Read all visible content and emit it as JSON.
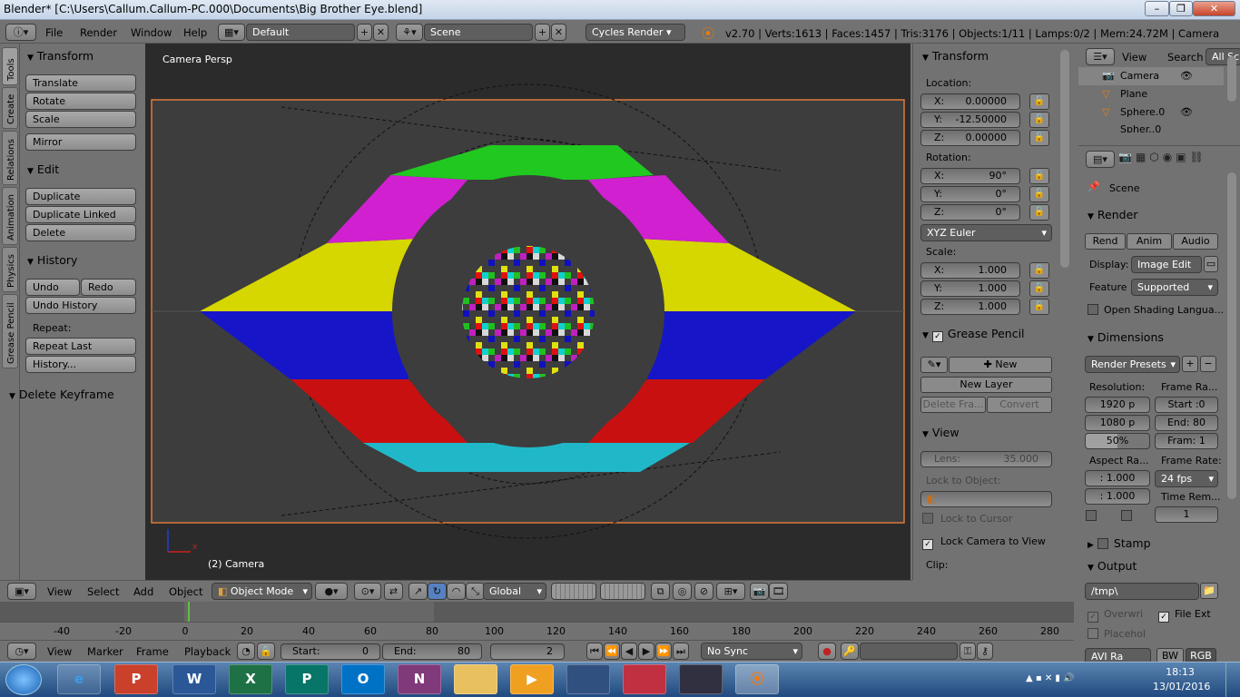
{
  "window": {
    "title": "Blender* [C:\\Users\\Callum.Callum-PC.000\\Documents\\Big Brother Eye.blend]",
    "minimize": "–",
    "maximize": "❐",
    "close": "✕"
  },
  "infobar": {
    "menus": [
      "File",
      "Render",
      "Window",
      "Help"
    ],
    "layout": "Default",
    "scene": "Scene",
    "engine": "Cycles Render",
    "stats": "v2.70 | Verts:1613 | Faces:1457 | Tris:3176 | Objects:1/11 | Lamps:0/2 | Mem:24.72M | Camera"
  },
  "tools": {
    "tabs": [
      "Tools",
      "Create",
      "Relations",
      "Animation",
      "Physics",
      "Grease Pencil"
    ],
    "transform": {
      "title": "Transform",
      "buttons": [
        "Translate",
        "Rotate",
        "Scale",
        "Mirror"
      ]
    },
    "edit": {
      "title": "Edit",
      "buttons": [
        "Duplicate",
        "Duplicate Linked",
        "Delete"
      ]
    },
    "history": {
      "title": "History",
      "undo": "Undo",
      "redo": "Redo",
      "undo_history": "Undo History",
      "repeat_label": "Repeat:",
      "repeat_last": "Repeat Last",
      "history": "History..."
    },
    "operator": {
      "title": "Delete Keyframe"
    }
  },
  "viewport": {
    "title": "Camera Persp",
    "object": "(2) Camera",
    "axis_x": "x"
  },
  "npanel": {
    "transform_title": "Transform",
    "location_label": "Location:",
    "location": {
      "x": "X:",
      "xv": "0.00000",
      "y": "Y:",
      "yv": "-12.50000",
      "z": "Z:",
      "zv": "0.00000"
    },
    "rotation_label": "Rotation:",
    "rotation": {
      "x": "X:",
      "xv": "90°",
      "y": "Y:",
      "yv": "0°",
      "z": "Z:",
      "zv": "0°"
    },
    "rotation_mode": "XYZ Euler",
    "scale_label": "Scale:",
    "scale": {
      "x": "X:",
      "xv": "1.000",
      "y": "Y:",
      "yv": "1.000",
      "z": "Z:",
      "zv": "1.000"
    },
    "grease_title": "Grease Pencil",
    "grease_new": "New",
    "new_layer": "New Layer",
    "delete_frame": "Delete Fra...",
    "convert": "Convert",
    "view_title": "View",
    "lens_label": "Lens:",
    "lens_value": "35.000",
    "lock_object": "Lock to Object:",
    "lock_cursor": "Lock to Cursor",
    "lock_camera": "Lock Camera to View",
    "clip": "Clip:"
  },
  "outliner": {
    "view": "View",
    "search": "Search",
    "filter": "All Sc",
    "items": [
      "Camera",
      "Plane",
      "Sphere.0",
      "Spher..0"
    ]
  },
  "properties": {
    "context": "Scene",
    "render_title": "Render",
    "render_tabs": [
      "Rend",
      "Anim",
      "Audio"
    ],
    "display_label": "Display:",
    "display_value": "Image Edit",
    "feature_label": "Feature",
    "feature_value": "Supported",
    "osl": "Open Shading Langua...",
    "dimensions_title": "Dimensions",
    "presets": "Render Presets",
    "resolution_label": "Resolution:",
    "res_x": "1920 p",
    "res_y": "1080 p",
    "res_pct": "50%",
    "frame_range_label": "Frame Ra...",
    "start": "Start :0",
    "end": "End: 80",
    "frame": "Fram: 1",
    "aspect_label": "Aspect Ra...",
    "aspect_x": ": 1.000",
    "aspect_y": ": 1.000",
    "frame_rate_label": "Frame Rate:",
    "fps": "24 fps",
    "time_remap_label": "Time Rem...",
    "time_remap": "1",
    "stamp": "Stamp",
    "output_title": "Output",
    "output_path": "/tmp\\",
    "overwrite": "Overwri",
    "file_ext": "File Ext",
    "placeholder": "Placehol",
    "format": "AVI Ra",
    "bw": "BW",
    "rgb": "RGB"
  },
  "header3d": {
    "menus": [
      "View",
      "Select",
      "Add",
      "Object"
    ],
    "mode": "Object Mode",
    "orientation": "Global"
  },
  "timeline": {
    "ticks": [
      "-40",
      "-20",
      "0",
      "20",
      "40",
      "60",
      "80",
      "100",
      "120",
      "140",
      "160",
      "180",
      "200",
      "220",
      "240",
      "260",
      "280"
    ]
  },
  "timeline_header": {
    "menus": [
      "View",
      "Marker",
      "Frame",
      "Playback"
    ],
    "start_label": "Start:",
    "start": "0",
    "end_label": "End:",
    "end": "80",
    "current": "2",
    "sync": "No Sync"
  },
  "taskbar": {
    "apps": [
      "e",
      "P",
      "W",
      "X",
      "P",
      "O",
      "N",
      "",
      "▶",
      "",
      "",
      "",
      "",
      ""
    ],
    "time": "18:13",
    "date": "13/01/2016"
  }
}
